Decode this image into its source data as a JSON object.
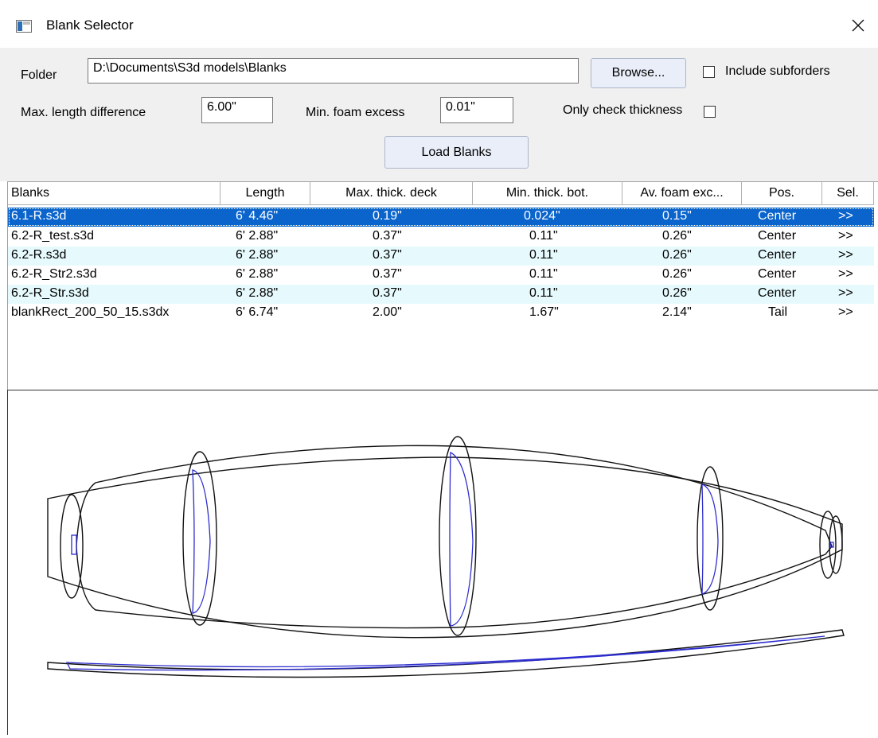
{
  "window": {
    "title": "Blank Selector"
  },
  "controls": {
    "folder_label": "Folder",
    "folder_value": "D:\\Documents\\S3d models\\Blanks",
    "browse_label": "Browse...",
    "include_subfolders_label": "Include subforders",
    "include_subfolders_checked": false,
    "max_length_label": "Max. length difference",
    "max_length_value": "6.00\"",
    "min_foam_label": "Min. foam excess",
    "min_foam_value": "0.01\"",
    "only_thickness_label": "Only check thickness",
    "only_thickness_checked": false,
    "load_label": "Load Blanks"
  },
  "table": {
    "columns": [
      "Blanks",
      "Length",
      "Max. thick. deck",
      "Min. thick. bot.",
      "Av. foam exc...",
      "Pos.",
      "Sel."
    ],
    "rows": [
      [
        "6.1-R.s3d",
        "6' 4.46\"",
        "0.19\"",
        "0.024\"",
        "0.15\"",
        "Center",
        ">>"
      ],
      [
        "6.2-R_test.s3d",
        "6' 2.88\"",
        "0.37\"",
        "0.11\"",
        "0.26\"",
        "Center",
        ">>"
      ],
      [
        "6.2-R.s3d",
        "6' 2.88\"",
        "0.37\"",
        "0.11\"",
        "0.26\"",
        "Center",
        ">>"
      ],
      [
        "6.2-R_Str2.s3d",
        "6' 2.88\"",
        "0.37\"",
        "0.11\"",
        "0.26\"",
        "Center",
        ">>"
      ],
      [
        "6.2-R_Str.s3d",
        "6' 2.88\"",
        "0.37\"",
        "0.11\"",
        "0.26\"",
        "Center",
        ">>"
      ],
      [
        "blankRect_200_50_15.s3dx",
        "6' 6.74\"",
        "2.00\"",
        "1.67\"",
        "2.14\"",
        "Tail",
        ">>"
      ]
    ],
    "selected_row": 0
  },
  "colors": {
    "selection": "#0a64cc",
    "board_outline": "#2b2bcf",
    "alt_row": "#e6fafd"
  }
}
